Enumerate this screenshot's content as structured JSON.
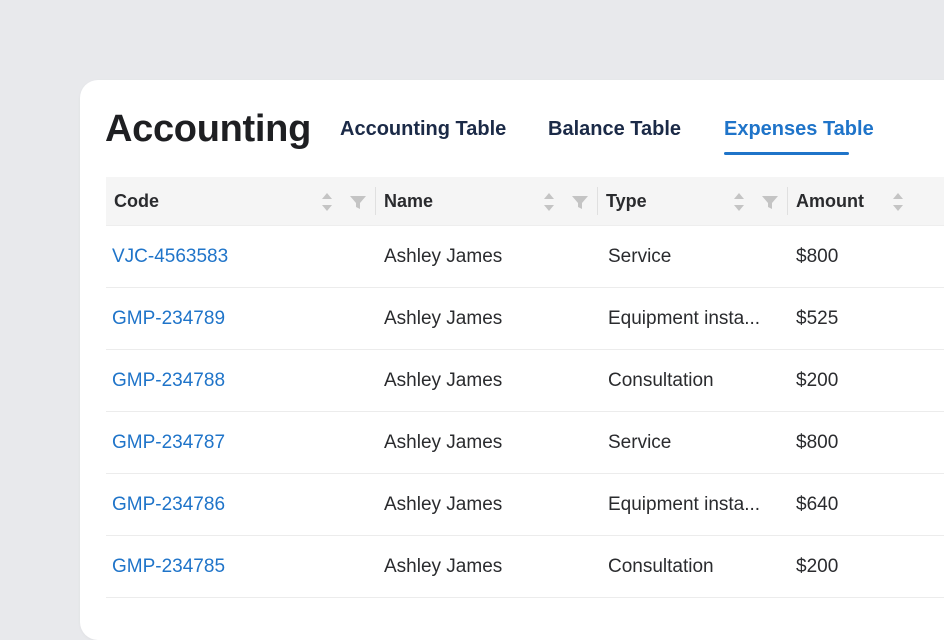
{
  "header": {
    "title": "Accounting",
    "tabs": [
      {
        "label": "Accounting Table",
        "active": false
      },
      {
        "label": "Balance Table",
        "active": false
      },
      {
        "label": "Expenses Table",
        "active": true
      }
    ]
  },
  "table": {
    "columns": [
      "Code",
      "Name",
      "Type",
      "Amount"
    ],
    "rows": [
      {
        "code": "VJC-4563583",
        "name": "Ashley James",
        "type": "Service",
        "amount": "$800"
      },
      {
        "code": "GMP-234789",
        "name": "Ashley James",
        "type": "Equipment insta...",
        "amount": "$525"
      },
      {
        "code": "GMP-234788",
        "name": "Ashley James",
        "type": "Consultation",
        "amount": "$200"
      },
      {
        "code": "GMP-234787",
        "name": "Ashley James",
        "type": "Service",
        "amount": "$800"
      },
      {
        "code": "GMP-234786",
        "name": "Ashley James",
        "type": "Equipment insta...",
        "amount": "$640"
      },
      {
        "code": "GMP-234785",
        "name": "Ashley James",
        "type": "Consultation",
        "amount": "$200"
      }
    ]
  },
  "icons": {
    "sort": "sort-icon",
    "filter": "filter-icon"
  },
  "colors": {
    "accent": "#1f74c9",
    "heading": "#1e1f22",
    "tab_text": "#1b2a47",
    "background": "#e8e9ec"
  }
}
